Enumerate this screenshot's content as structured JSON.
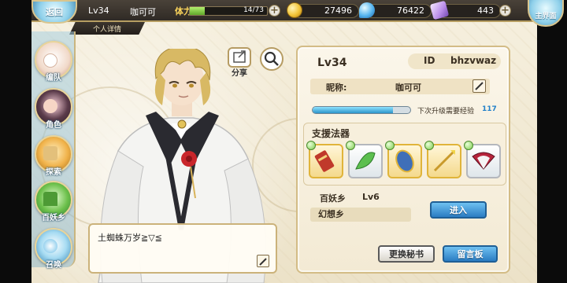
{
  "top_bar": {
    "back_label": "返回",
    "level": "Lv34",
    "nickname": "咖可可",
    "stamina_label": "体力",
    "stamina_value": "14/73",
    "stamina_fraction": 0.19,
    "gold": "27496",
    "gems": "76422",
    "tickets": "443",
    "main_label": "主界面"
  },
  "profile_tab": "个人详情",
  "nav": {
    "items": [
      {
        "label": "编队"
      },
      {
        "label": "角色"
      },
      {
        "label": "探索"
      },
      {
        "label": "百妖乡"
      },
      {
        "label": "召唤"
      }
    ]
  },
  "share_label": "分享",
  "bubble_text": "土蜘蛛万岁≧▽≦",
  "panel": {
    "level": "Lv34",
    "id_label": "ID",
    "id_value": "bhzvwaz",
    "nick_label": "昵称:",
    "nick_value": "咖可可",
    "exp_label": "下次升级需要经验",
    "exp_value": "117",
    "exp_fraction": 0.82,
    "support_title": "支援法器",
    "realm_name": "百妖乡",
    "realm_level": "Lv6",
    "realm_place": "幻想乡",
    "enter_label": "进入",
    "change_label": "更换秘书",
    "message_label": "留言板"
  },
  "colors": {
    "accent_gold": "#d3bc86",
    "button_blue": "#2a7cc2",
    "exp_blue": "#2b93c9",
    "stamina_green": "#5fa72a"
  }
}
